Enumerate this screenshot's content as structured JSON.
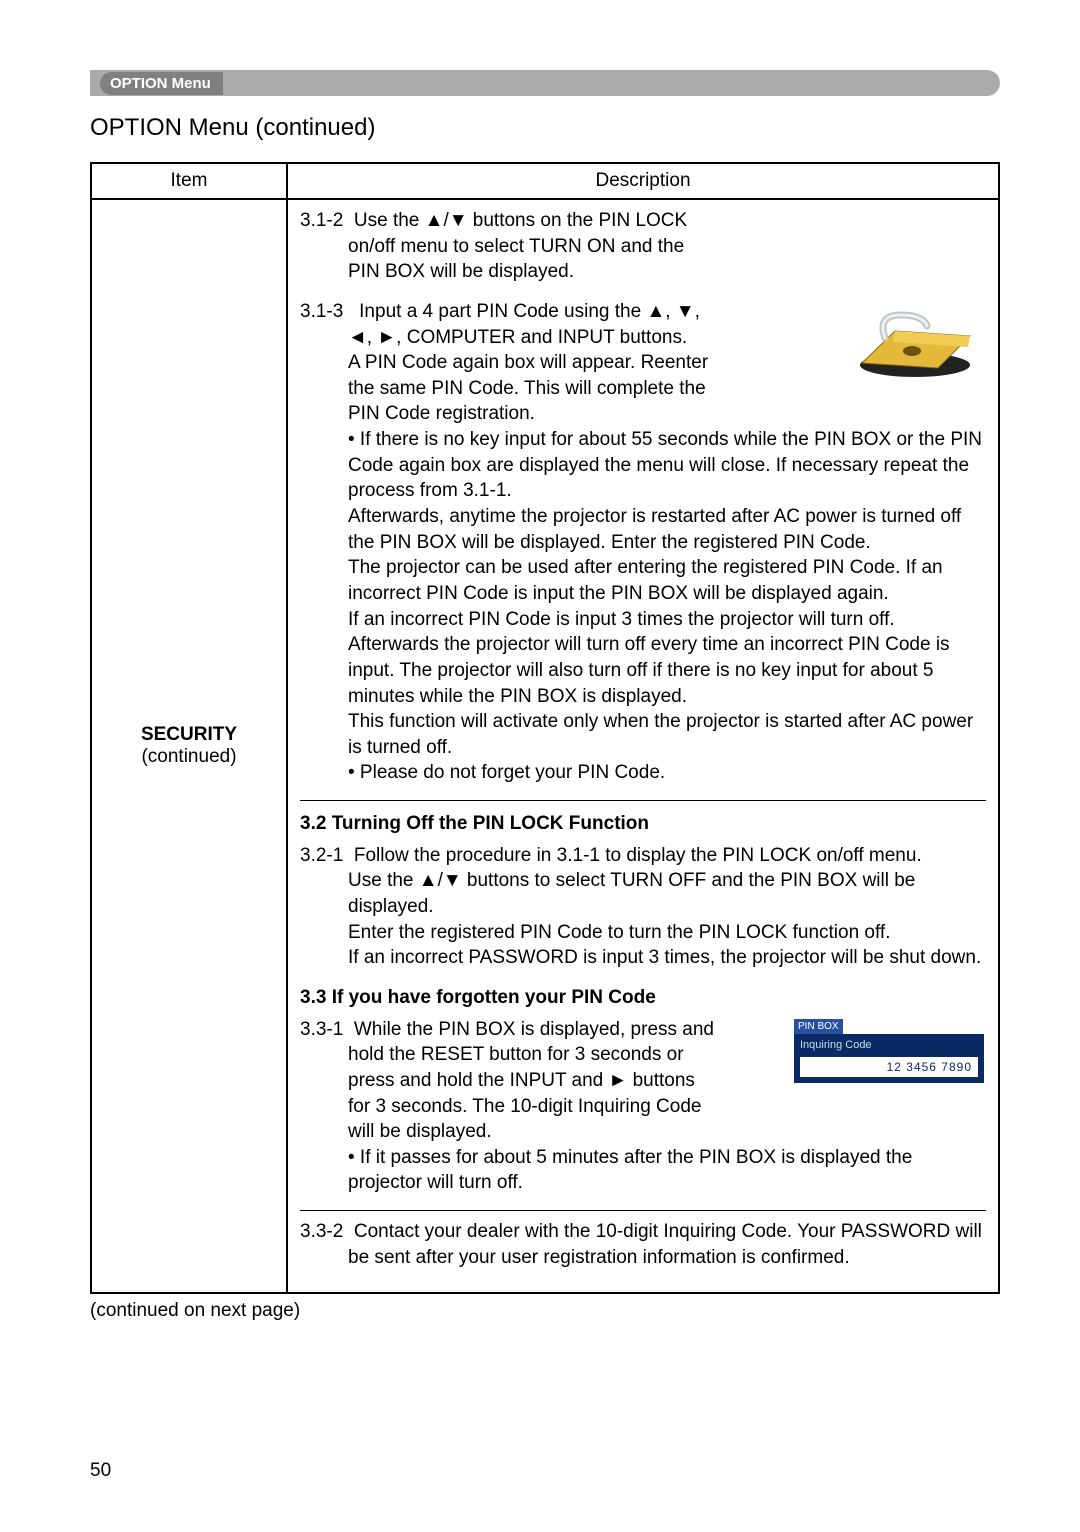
{
  "header": {
    "pill": "OPTION Menu"
  },
  "title": "OPTION Menu (continued)",
  "table": {
    "head_item": "Item",
    "head_desc": "Description",
    "item_label_1": "SECURITY",
    "item_label_2": "(continued)"
  },
  "b312": {
    "num": "3.1-2",
    "l1": "Use the ▲/▼ buttons on the PIN LOCK",
    "l2": "on/off menu to select TURN ON and the",
    "l3": "PIN BOX will be displayed."
  },
  "b313": {
    "num": "3.1-3",
    "l1": "Input a 4 part PIN Code using the ▲, ▼,",
    "l2": "◄, ►, COMPUTER and INPUT buttons.",
    "l3": "A PIN Code again box will appear. Reenter",
    "l4": "the same PIN Code. This will complete the",
    "l5": "PIN Code registration.",
    "bul1": "• If there is no key input for about 55 seconds while the PIN BOX or the PIN Code again box are displayed the menu will close. If necessary repeat the process from 3.1-1.",
    "p1": "Afterwards, anytime the projector is restarted after AC power is turned off the PIN BOX will be displayed. Enter the registered PIN Code.",
    "p2": "The projector can be used after entering the registered PIN Code. If an incorrect PIN Code is input the PIN BOX will be displayed again.",
    "p3": "If an incorrect PIN Code is input 3 times the projector will turn off. Afterwards the projector will turn off every time an incorrect PIN Code is input. The projector will also turn off if there is no key input for about 5 minutes while the PIN BOX is displayed.",
    "p4": "This function will activate only when the projector is started after AC power is turned off.",
    "bul2": "• Please do not forget your PIN Code."
  },
  "s32": {
    "heading": "3.2 Turning Off the PIN LOCK Function",
    "num": "3.2-1",
    "l1": "Follow the procedure in 3.1-1 to display the PIN LOCK on/off menu.",
    "l2": "Use the ▲/▼ buttons to select TURN OFF and the PIN BOX will be displayed.",
    "l3": "Enter the registered PIN Code to turn the PIN LOCK function off.",
    "l4": "If an incorrect PASSWORD is input 3 times, the projector will be shut down."
  },
  "s33": {
    "heading": "3.3 If you have forgotten your PIN Code",
    "num1": "3.3-1",
    "a_l1": "While the PIN BOX is displayed, press and",
    "a_l2": "hold the RESET button for 3 seconds or",
    "a_l3": "press and hold the INPUT and ► buttons",
    "a_l4": "for 3 seconds. The 10-digit Inquiring Code",
    "a_l5": "will be displayed.",
    "a_bul": "• If it passes for about 5 minutes after the PIN BOX is displayed the projector will turn off.",
    "num2": "3.3-2",
    "b_l1": "Contact your dealer with the 10-digit Inquiring Code. Your PASSWORD will be sent after your user registration information is confirmed."
  },
  "pinbox": {
    "title": "PIN BOX",
    "label": "Inquiring Code",
    "value": "12 3456 7890"
  },
  "footer": {
    "continued": "(continued on next page)",
    "page": "50"
  }
}
